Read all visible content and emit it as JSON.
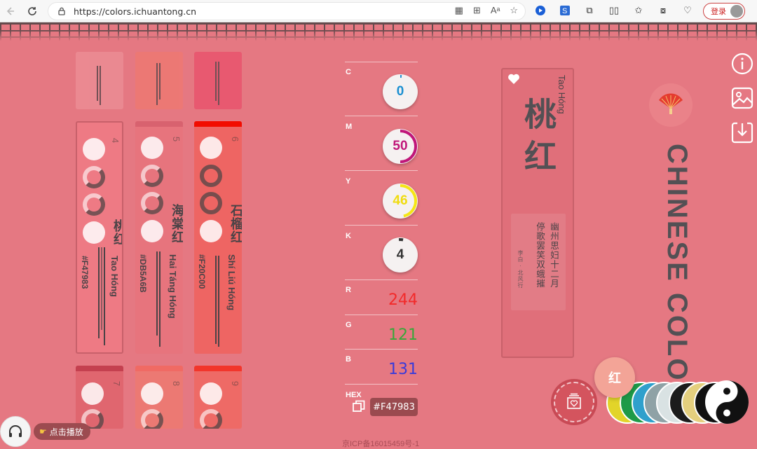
{
  "browser": {
    "url": "https://colors.ichuantong.cn",
    "login_label": "登录"
  },
  "cards": [
    {
      "num": "4",
      "name": "桃红",
      "hex": "#F47983",
      "pinyin": "Tao Hóng",
      "color": "#f47983"
    },
    {
      "num": "5",
      "name": "海棠红",
      "hex": "#DB5A6B",
      "pinyin": "Hai Táng Hóng",
      "color": "#db5a6b"
    },
    {
      "num": "6",
      "name": "石榴红",
      "hex": "#F20C00",
      "pinyin": "Shí Liú Hóng",
      "color": "#f20c00"
    },
    {
      "num": "7",
      "color": "#d6495a"
    },
    {
      "num": "8",
      "color": "#f06a64"
    },
    {
      "num": "9",
      "color": "#f2352b"
    }
  ],
  "cmyk": {
    "c": {
      "label": "C",
      "value": "0",
      "color": "#1a8fd1"
    },
    "m": {
      "label": "M",
      "value": "50",
      "color": "#c0177a"
    },
    "y": {
      "label": "Y",
      "value": "46",
      "color": "#f5e615"
    },
    "k": {
      "label": "K",
      "value": "4",
      "color": "#333333"
    }
  },
  "rgb": {
    "r": {
      "label": "R",
      "value": "244",
      "color": "#f22a2a"
    },
    "g": {
      "label": "G",
      "value": "121",
      "color": "#3aa73a"
    },
    "b": {
      "label": "B",
      "value": "131",
      "color": "#3a3ad9"
    }
  },
  "hex": {
    "label": "HEX",
    "value": "#F47983"
  },
  "detail": {
    "name": "桃红",
    "pinyin": "Tao Hóng",
    "poem_line_1": "幽州思妇十二月",
    "poem_line_2": "停歌罢笑双蛾摧",
    "poem_author": "李白 · 北风行"
  },
  "brand": "CHINESE COLORS",
  "bottom": {
    "icp": "京ICP备16015459号-1",
    "play_label": "点击播放",
    "hong_label": "红"
  },
  "swatch_colors": [
    "#e2d429",
    "#1e9a48",
    "#2fa0cc",
    "#8fa2a6",
    "#d9e2e3",
    "#1c1c1c",
    "#e4cf7e",
    "#111111"
  ]
}
